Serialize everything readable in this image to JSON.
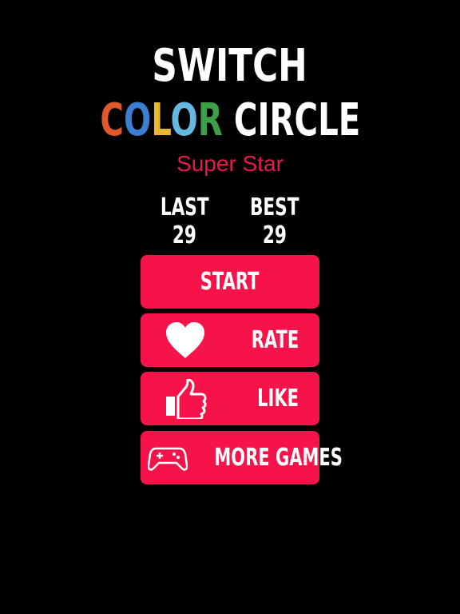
{
  "title": {
    "line1": "SWITCH",
    "color_letters": [
      {
        "char": "C",
        "color": "#e0582c"
      },
      {
        "char": "O",
        "color": "#3a7fd0"
      },
      {
        "char": "L",
        "color": "#e9b62f"
      },
      {
        "char": "O",
        "color": "#67b8e0"
      },
      {
        "char": "R",
        "color": "#3f9f47"
      }
    ],
    "line2_rest": "CIRCLE",
    "subtitle": "Super Star"
  },
  "scores": {
    "last_label": "LAST",
    "last_value": "29",
    "best_label": "BEST",
    "best_value": "29"
  },
  "menu": {
    "start_label": "START",
    "rate_label": "RATE",
    "like_label": "LIKE",
    "more_games_label": "MORE GAMES"
  },
  "colors": {
    "background": "#000000",
    "button": "#f5134a",
    "subtitle": "#e8194b",
    "text": "#ffffff"
  },
  "icons": {
    "rate": "heart-icon",
    "like": "thumbs-up-icon",
    "more_games": "gamepad-icon"
  }
}
